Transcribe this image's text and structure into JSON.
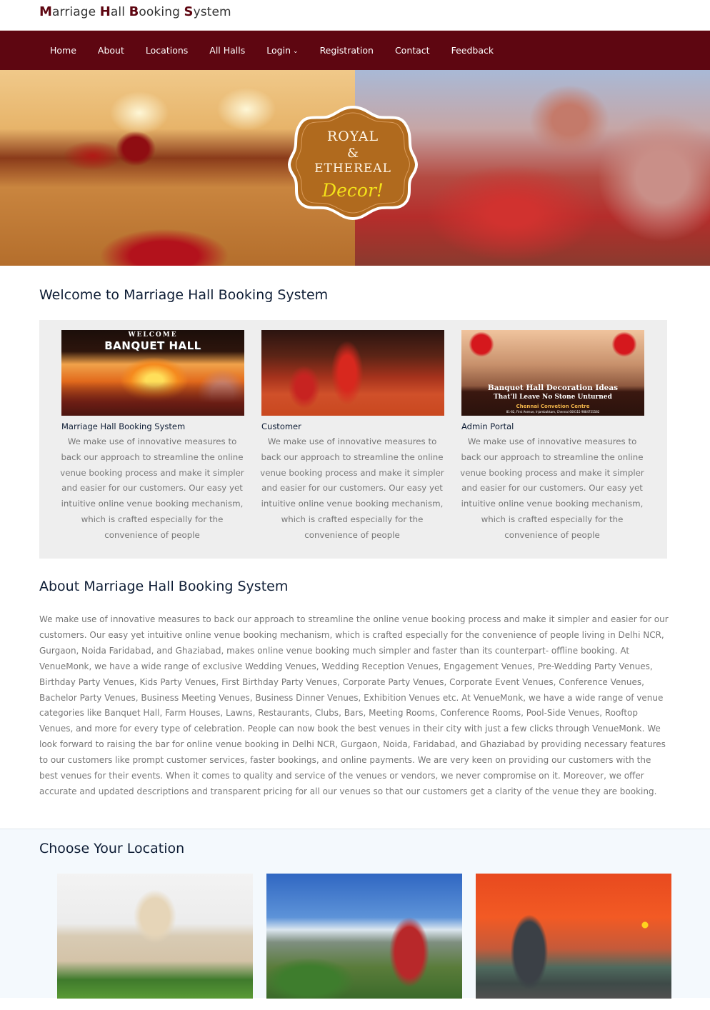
{
  "brand": {
    "words": [
      {
        "initial": "M",
        "rest": "arriage"
      },
      {
        "initial": "H",
        "rest": "all"
      },
      {
        "initial": "B",
        "rest": "ooking"
      },
      {
        "initial": "S",
        "rest": "ystem"
      }
    ],
    "accent_color": "#5e0611"
  },
  "nav": {
    "items": [
      {
        "label": "Home"
      },
      {
        "label": "About"
      },
      {
        "label": "Locations"
      },
      {
        "label": "All Halls"
      },
      {
        "label": "Login",
        "icon": "chevron-down-icon",
        "glyph": "⌄"
      },
      {
        "label": "Registration"
      },
      {
        "label": "Contact"
      },
      {
        "label": "Feedback"
      }
    ],
    "background_color": "#5e0611"
  },
  "hero": {
    "badge": {
      "line1": "ROYAL",
      "line2": "&",
      "line3": "ETHEREAL",
      "line4": "Decor!"
    }
  },
  "welcome": {
    "heading": "Welcome to Marriage Hall Booking System",
    "cards": [
      {
        "title": "Marriage Hall Booking System",
        "image_caption_top": "WELCOME",
        "image_caption_main": "BANQUET HALL",
        "description": "We make use of innovative measures to back our approach to streamline the online venue booking process and make it simpler and easier for our customers. Our easy yet intuitive online venue booking mechanism, which is crafted especially for the convenience of people"
      },
      {
        "title": "Customer",
        "description": "We make use of innovative measures to back our approach to streamline the online venue booking process and make it simpler and easier for our customers. Our easy yet intuitive online venue booking mechanism, which is crafted especially for the convenience of people"
      },
      {
        "title": "Admin Portal",
        "image_caption_1": "Banquet Hall Decoration Ideas",
        "image_caption_2": "That'll Leave No Stone Unturned",
        "image_caption_3": "Chennai Convetion Centre",
        "image_caption_4": "81-82, First Avenue, Injambakkam, Chennai 600115     9884755582",
        "description": "We make use of innovative measures to back our approach to streamline the online venue booking process and make it simpler and easier for our customers. Our easy yet intuitive online venue booking mechanism, which is crafted especially for the convenience of people"
      }
    ]
  },
  "about": {
    "heading": "About Marriage Hall Booking System",
    "body": "We make use of innovative measures to back our approach to streamline the online venue booking process and make it simpler and easier for our customers. Our easy yet intuitive online venue booking mechanism, which is crafted especially for the convenience of people living in Delhi NCR, Gurgaon, Noida Faridabad, and Ghaziabad, makes online venue booking much simpler and faster than its counterpart- offline booking. At VenueMonk, we have a wide range of exclusive Wedding Venues, Wedding Reception Venues, Engagement Venues, Pre-Wedding Party Venues, Birthday Party Venues, Kids Party Venues, First Birthday Party Venues, Corporate Party Venues, Corporate Event Venues, Conference Venues, Bachelor Party Venues, Business Meeting Venues, Business Dinner Venues, Exhibition Venues etc. At VenueMonk, we have a wide range of venue categories like Banquet Hall, Farm Houses, Lawns, Restaurants, Clubs, Bars, Meeting Rooms, Conference Rooms, Pool-Side Venues, Rooftop Venues, and more for every type of celebration. People can now book the best venues in their city with just a few clicks through VenueMonk. We look forward to raising the bar for online venue booking in Delhi NCR, Gurgaon, Noida, Faridabad, and Ghaziabad by providing necessary features to our customers like prompt customer services, faster bookings, and online payments. We are very keen on providing our customers with the best venues for their events. When it comes to quality and service of the venues or vendors, we never compromise on it. Moreover, we offer accurate and updated descriptions and transparent pricing for all our venues so that our customers get a clarity of the venue they are booking."
  },
  "locations": {
    "heading": "Choose Your Location",
    "items": [
      {
        "image": "vidhana-soudha-photo"
      },
      {
        "image": "chennai-central-photo"
      },
      {
        "image": "india-gate-photo"
      }
    ]
  }
}
